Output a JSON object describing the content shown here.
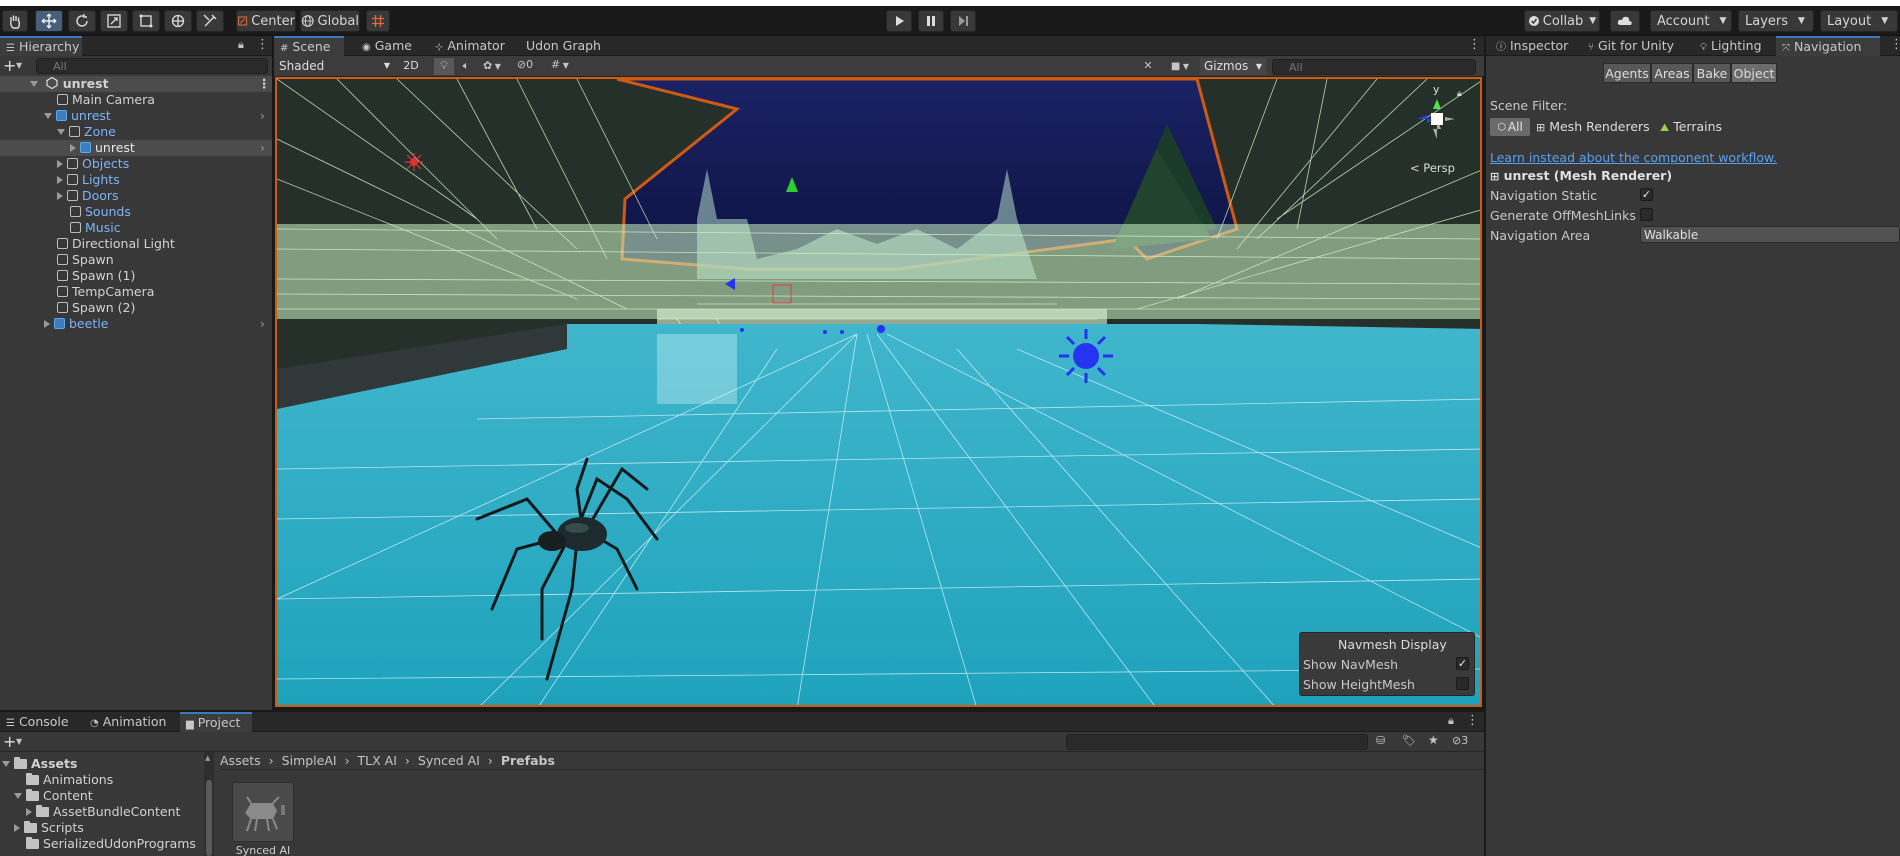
{
  "toolbar": {
    "center_label": "Center",
    "global_label": "Global",
    "collab_label": "Collab",
    "account_label": "Account",
    "layers_label": "Layers",
    "layout_label": "Layout"
  },
  "hierarchy": {
    "tab_label": "Hierarchy",
    "search_placeholder": "All",
    "scene_name": "unrest",
    "items": [
      {
        "label": "Main Camera"
      },
      {
        "label": "unrest"
      },
      {
        "label": "Zone"
      },
      {
        "label": "unrest"
      },
      {
        "label": "Objects"
      },
      {
        "label": "Lights"
      },
      {
        "label": "Doors"
      },
      {
        "label": "Sounds"
      },
      {
        "label": "Music"
      },
      {
        "label": "Directional Light"
      },
      {
        "label": "Spawn"
      },
      {
        "label": "Spawn (1)"
      },
      {
        "label": "TempCamera"
      },
      {
        "label": "Spawn (2)"
      },
      {
        "label": "beetle"
      }
    ]
  },
  "scene_tabs": {
    "scene": "Scene",
    "game": "Game",
    "animator": "Animator",
    "udon": "Udon Graph"
  },
  "scene_toolbar": {
    "shading": "Shaded",
    "mode_2d": "2D",
    "hidden_count": "0",
    "gizmos": "Gizmos",
    "search_placeholder": "All",
    "persp_label": "< Persp",
    "axis_y": "y"
  },
  "navmesh_overlay": {
    "title": "Navmesh Display",
    "show_navmesh": "Show NavMesh",
    "show_navmesh_checked": true,
    "show_heightmesh": "Show HeightMesh",
    "show_heightmesh_checked": false
  },
  "inspector_tabs": {
    "inspector": "Inspector",
    "git": "Git for Unity",
    "lighting": "Lighting",
    "navigation": "Navigation"
  },
  "navigation": {
    "buttons": [
      "Agents",
      "Areas",
      "Bake",
      "Object"
    ],
    "scene_filter_label": "Scene Filter:",
    "filter_all": "All",
    "filter_mesh": "Mesh Renderers",
    "filter_terrains": "Terrains",
    "learn_link": "Learn instead about the component workflow.",
    "object_title": "unrest (Mesh Renderer)",
    "nav_static_label": "Navigation Static",
    "nav_static_checked": true,
    "offmesh_label": "Generate OffMeshLinks",
    "offmesh_checked": false,
    "area_label": "Navigation Area",
    "area_value": "Walkable"
  },
  "bottom_tabs": {
    "console": "Console",
    "animation": "Animation",
    "project": "Project",
    "hidden_count": "3"
  },
  "project": {
    "tree": [
      {
        "label": "Assets"
      },
      {
        "label": "Animations"
      },
      {
        "label": "Content"
      },
      {
        "label": "AssetBundleContent"
      },
      {
        "label": "Scripts"
      },
      {
        "label": "SerializedUdonPrograms"
      }
    ],
    "breadcrumb": [
      "Assets",
      "SimpleAI",
      "TLX AI",
      "Synced AI",
      "Prefabs"
    ],
    "asset_label": "Synced AI"
  },
  "colors": {
    "accent": "#3a79bb",
    "selection_outline": "#d05a10",
    "navmesh": "#1ea8c4"
  }
}
